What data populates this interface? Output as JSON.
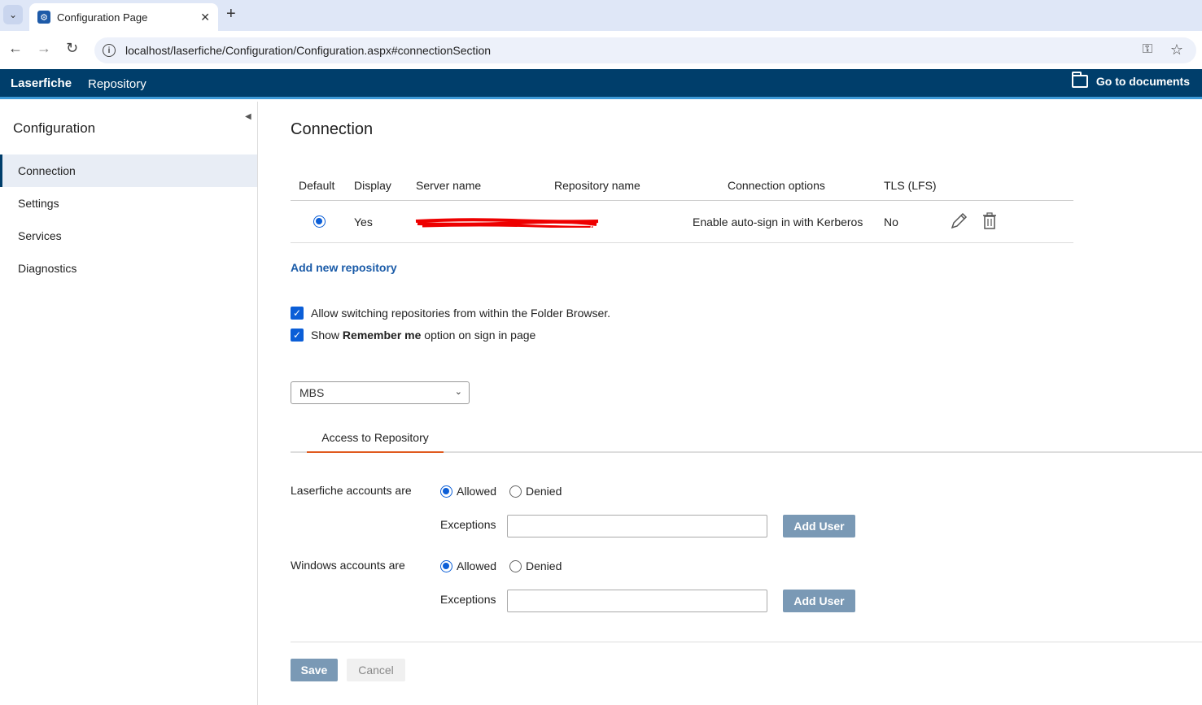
{
  "browser": {
    "tab_title": "Configuration Page",
    "url": "localhost/laserfiche/Configuration/Configuration.aspx#connectionSection"
  },
  "header": {
    "brand": "Laserfiche",
    "product": "Repository",
    "goto_label": "Go to documents"
  },
  "sidebar": {
    "title": "Configuration",
    "items": [
      {
        "label": "Connection",
        "active": true
      },
      {
        "label": "Settings"
      },
      {
        "label": "Services"
      },
      {
        "label": "Diagnostics"
      }
    ]
  },
  "main": {
    "title": "Connection",
    "table": {
      "headers": [
        "Default",
        "Display",
        "Server name",
        "Repository name",
        "Connection options",
        "TLS (LFS)"
      ],
      "rows": [
        {
          "default": true,
          "display": "Yes",
          "server": "",
          "repository": "",
          "options": "Enable auto-sign in with Kerberos",
          "tls": "No"
        }
      ]
    },
    "add_repository": "Add new repository",
    "checks": {
      "allow_switching": "Allow switching repositories from within the Folder Browser.",
      "remember_prefix": "Show ",
      "remember_bold": "Remember me",
      "remember_suffix": " option on sign in page"
    },
    "repo_select": "MBS",
    "tab_access": "Access to Repository",
    "laserfiche_accounts": {
      "label": "Laserfiche accounts are",
      "allowed": "Allowed",
      "denied": "Denied",
      "exceptions": "Exceptions",
      "add_user": "Add User"
    },
    "windows_accounts": {
      "label": "Windows accounts are",
      "allowed": "Allowed",
      "denied": "Denied",
      "exceptions": "Exceptions",
      "add_user": "Add User"
    },
    "save": "Save",
    "cancel": "Cancel"
  }
}
